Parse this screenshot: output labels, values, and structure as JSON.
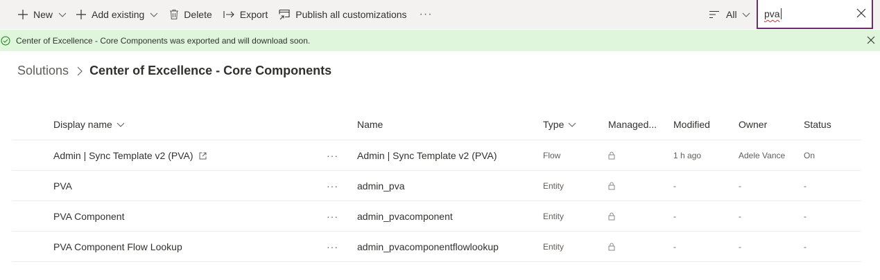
{
  "toolbar": {
    "new_label": "New",
    "add_existing_label": "Add existing",
    "delete_label": "Delete",
    "export_label": "Export",
    "publish_label": "Publish all customizations",
    "more_label": "···",
    "filter_label": "All",
    "search_value": "pva"
  },
  "message": {
    "text": "Center of Excellence - Core Components was exported and will download soon."
  },
  "breadcrumb": {
    "root": "Solutions",
    "current": "Center of Excellence - Core Components"
  },
  "table": {
    "headers": {
      "display_name": "Display name",
      "name": "Name",
      "type": "Type",
      "managed": "Managed...",
      "modified": "Modified",
      "owner": "Owner",
      "status": "Status"
    },
    "rows": [
      {
        "display_name": "Admin | Sync Template v2 (PVA)",
        "more": "···",
        "name": "Admin | Sync Template v2 (PVA)",
        "type": "Flow",
        "modified": "1 h ago",
        "owner": "Adele Vance",
        "status": "On"
      },
      {
        "display_name": "PVA",
        "more": "···",
        "name": "admin_pva",
        "type": "Entity",
        "modified": "-",
        "owner": "-",
        "status": "-"
      },
      {
        "display_name": "PVA Component",
        "more": "···",
        "name": "admin_pvacomponent",
        "type": "Entity",
        "modified": "-",
        "owner": "-",
        "status": "-"
      },
      {
        "display_name": "PVA Component Flow Lookup",
        "more": "···",
        "name": "admin_pvacomponentflowlookup",
        "type": "Entity",
        "modified": "-",
        "owner": "-",
        "status": "-"
      }
    ]
  },
  "colors": {
    "accent": "#6c2b6e",
    "success_bg": "#dff6dd",
    "success_icon": "#107c10"
  },
  "icons": [
    "plus-icon",
    "chevron-down-icon",
    "trash-icon",
    "export-arrow-icon",
    "publish-icon",
    "more-icon",
    "filter-lines-icon",
    "close-icon",
    "check-circle-icon",
    "chevron-right-icon",
    "open-external-icon",
    "lock-icon"
  ]
}
